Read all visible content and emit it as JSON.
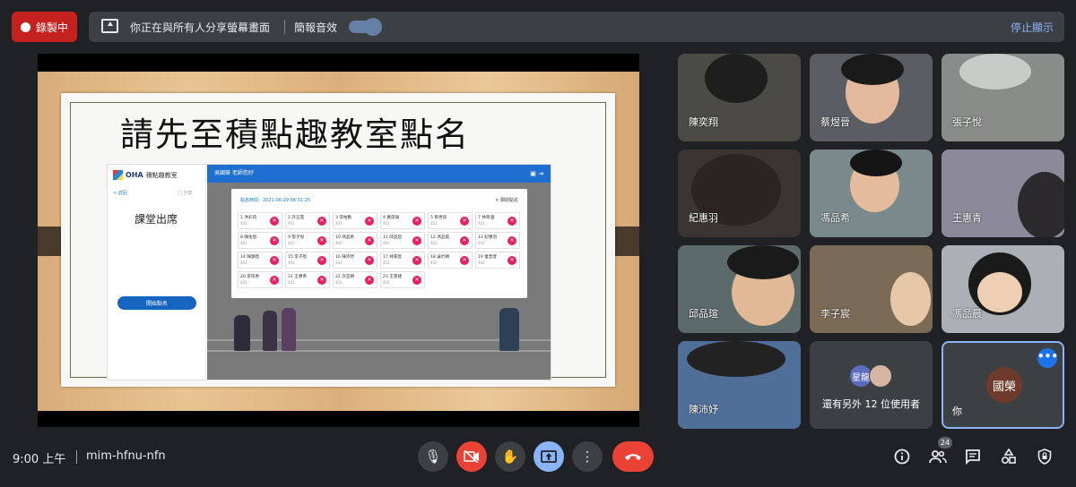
{
  "top_bar": {
    "record_label": "錄製中",
    "share_notice": "你正在與所有人分享螢幕畫面",
    "audio_label": "簡報音效",
    "stop_label": "停止顯示"
  },
  "slide": {
    "title": "請先至積點趣教室點名",
    "app": {
      "logo": "OHA",
      "logo_text": "積點趣教室",
      "back": "< 返回",
      "back_right": "□ 分享",
      "side_title": "課堂出席",
      "start_button": "開始點名",
      "header_text": "吳國榮 老師您好",
      "dialog_time": "點名時間：2021-06-29 08:31:25",
      "dialog_close": "✕ 關閉點名",
      "students": [
        {
          "name": "1 洪彩筠",
          "cls": "402"
        },
        {
          "name": "2 許正雲",
          "cls": "402"
        },
        {
          "name": "3 李柏勳",
          "cls": "402"
        },
        {
          "name": "4 黃庠瑜",
          "cls": "402"
        },
        {
          "name": "5 蔡煜晉",
          "cls": "402"
        },
        {
          "name": "7 林筱涵",
          "cls": "402"
        },
        {
          "name": "8 陳佑恩",
          "cls": "402"
        },
        {
          "name": "9 張子悅",
          "cls": "402"
        },
        {
          "name": "10 馮品希",
          "cls": "402"
        },
        {
          "name": "11 邱品瑄",
          "cls": "402"
        },
        {
          "name": "12 馮品晨",
          "cls": "402"
        },
        {
          "name": "13 紀惠羽",
          "cls": "402"
        },
        {
          "name": "14 陳韻瑄",
          "cls": "402"
        },
        {
          "name": "15 李子宸",
          "cls": "402"
        },
        {
          "name": "16 陳沛妤",
          "cls": "402"
        },
        {
          "name": "17 林家宸",
          "cls": "402"
        },
        {
          "name": "18 吳忻穎",
          "cls": "402"
        },
        {
          "name": "19 童萱萱",
          "cls": "402"
        },
        {
          "name": "20 李筠希",
          "cls": "402"
        },
        {
          "name": "21 王惠青",
          "cls": "402"
        },
        {
          "name": "22 許宜穎",
          "cls": "402"
        },
        {
          "name": "23 王張捷",
          "cls": "402"
        }
      ]
    }
  },
  "participants": [
    {
      "name": "陳奕翔",
      "bg": "#4b4a44"
    },
    {
      "name": "蔡煜晉",
      "bg": "#5a5d63"
    },
    {
      "name": "張子悅",
      "bg": "#8a8c8a"
    },
    {
      "name": "紀惠羽",
      "bg": "#3a3533"
    },
    {
      "name": "馮品希",
      "bg": "#7a8a8c"
    },
    {
      "name": "王惠青",
      "bg": "#8c8a9a"
    },
    {
      "name": "邱品瑄",
      "bg": "#5d6a6c"
    },
    {
      "name": "李子宸",
      "bg": "#7b6a55"
    },
    {
      "name": "馮品晨",
      "bg": "#aab0b5"
    },
    {
      "name": "陳沛妤",
      "bg": "#4f6f99"
    }
  ],
  "more_participants": {
    "avatar_label": "星龍",
    "text": "還有另外 12 位使用者"
  },
  "self": {
    "avatar": "國榮",
    "name": "你",
    "more": "•••"
  },
  "bottom_bar": {
    "time": "9:00 上午",
    "meeting_code": "mim-hfnu-nfn",
    "people_count": "24"
  },
  "colors": {
    "background": "#202124",
    "record": "#c5221f",
    "accent": "#8ab4f8",
    "end_call": "#ea4335",
    "dialog_x": "#e91e63"
  }
}
